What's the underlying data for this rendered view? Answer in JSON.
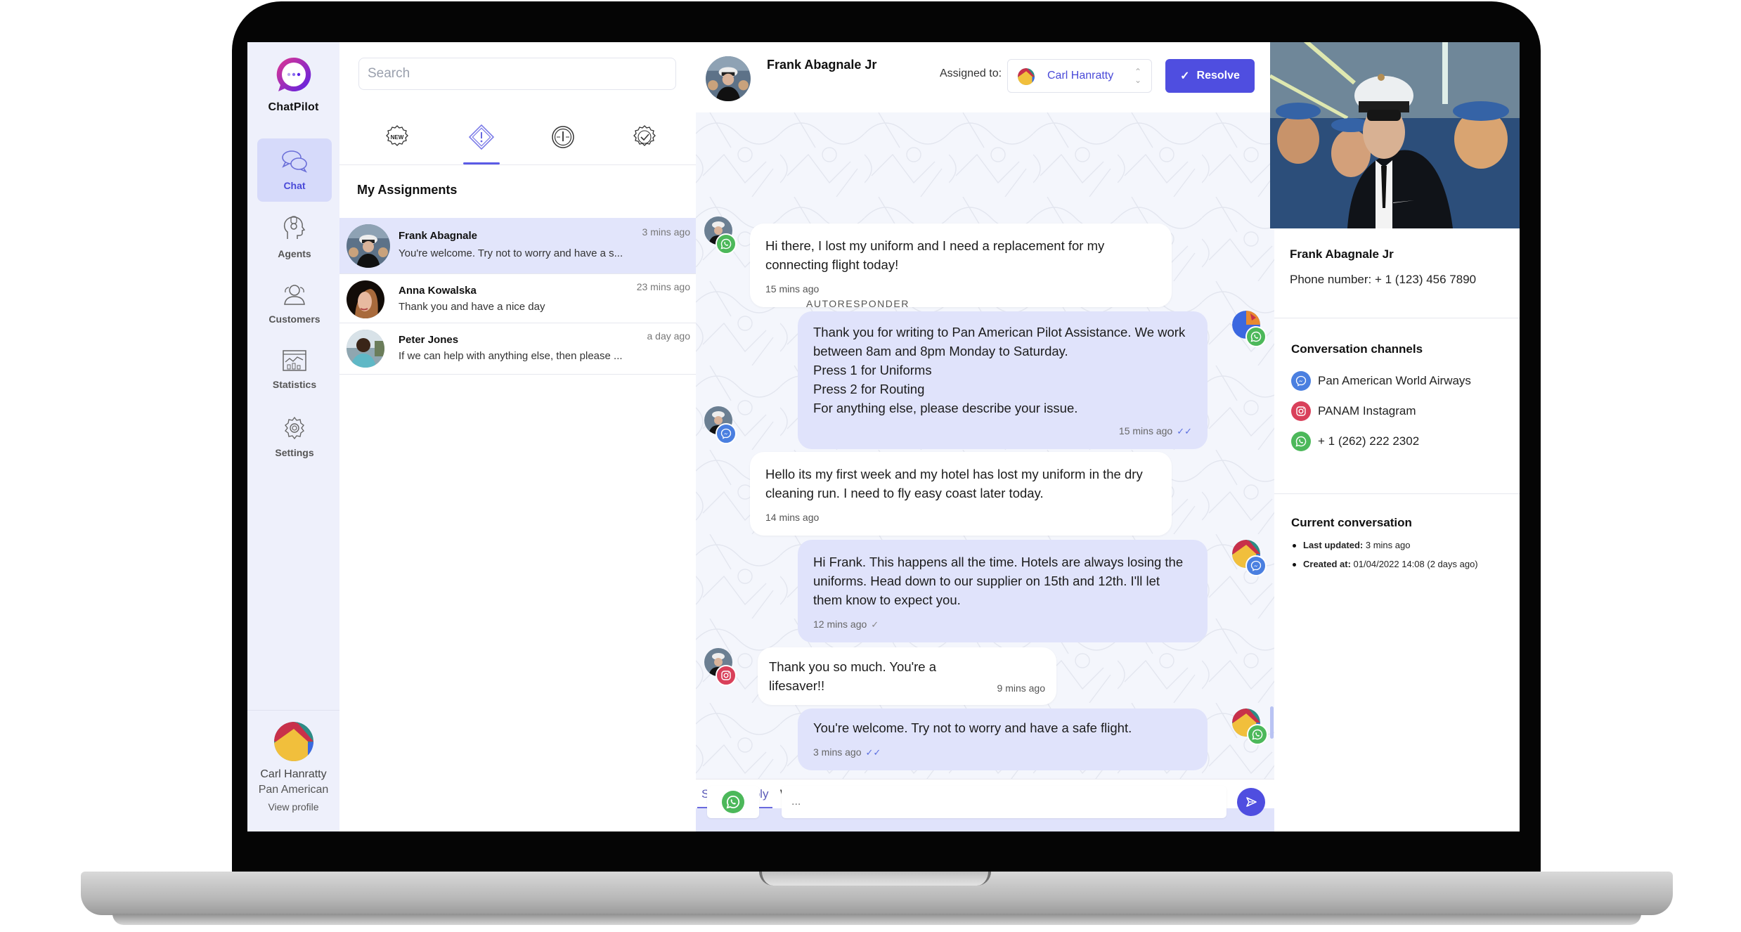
{
  "app": {
    "name": "ChatPilot",
    "brand_color": "#4f4ee0",
    "accent_light": "#e0e3fb"
  },
  "sidebar": {
    "items": [
      {
        "label": "Chat",
        "icon": "chat-bubbles-icon",
        "active": true
      },
      {
        "label": "Agents",
        "icon": "agent-headset-icon",
        "active": false
      },
      {
        "label": "Customers",
        "icon": "customers-icon",
        "active": false
      },
      {
        "label": "Statistics",
        "icon": "statistics-icon",
        "active": false
      },
      {
        "label": "Settings",
        "icon": "settings-gear-icon",
        "active": false
      }
    ],
    "profile": {
      "name": "Carl Hanratty",
      "organization": "Pan American",
      "link_label": "View profile"
    }
  },
  "conversation_list": {
    "search_placeholder": "Search",
    "filter_tabs": [
      {
        "icon": "new-badge-icon",
        "label": "NEW",
        "active": false
      },
      {
        "icon": "alert-diamond-icon",
        "active": true
      },
      {
        "icon": "clock-icon",
        "active": false
      },
      {
        "icon": "checkmark-badge-icon",
        "active": false
      }
    ],
    "section_title": "My Assignments",
    "items": [
      {
        "name": "Frank Abagnale",
        "preview": "You're welcome. Try not to worry and have a s...",
        "time": "3 mins ago",
        "active": true
      },
      {
        "name": "Anna Kowalska",
        "preview": "Thank you and have a nice day",
        "time": "23 mins ago",
        "active": false
      },
      {
        "name": "Peter Jones",
        "preview": "If we can help with anything else, then please ...",
        "time": "a day ago",
        "active": false
      }
    ]
  },
  "chat": {
    "contact_name": "Frank Abagnale Jr",
    "assigned_label": "Assigned to:",
    "assignee": "Carl Hanratty",
    "resolve_label": "Resolve",
    "messages": [
      {
        "direction": "in",
        "channel": "whatsapp",
        "text": "Hi there, I lost my uniform and I need a replacement for my connecting flight today!",
        "time": "15 mins ago"
      },
      {
        "direction": "out",
        "channel": "whatsapp",
        "label": "AUTORESPONDER",
        "lines": [
          "Thank you for writing to Pan American Pilot Assistance. We work between 8am and 8pm Monday to Saturday.",
          "Press 1 for Uniforms",
          "Press 2 for Routing",
          "For anything else, please describe your issue."
        ],
        "time": "15 mins ago",
        "status": "read"
      },
      {
        "direction": "in",
        "channel": "messenger",
        "text": "Hello its my first week and my hotel has lost my uniform in the dry cleaning run. I need to fly easy coast later today.",
        "time": "14 mins ago"
      },
      {
        "direction": "out",
        "channel": "messenger",
        "text": "Hi Frank. This happens all the time. Hotels are always losing the uniforms. Head down to our supplier on 15th and 12th. I'll let them know to expect you.",
        "time": "12 mins ago",
        "status": "sent"
      },
      {
        "direction": "in",
        "channel": "instagram",
        "text": "Thank you so much. You're a lifesaver!!",
        "time": "9 mins ago"
      },
      {
        "direction": "out",
        "channel": "whatsapp",
        "text": "You're welcome. Try not to worry and have a safe flight.",
        "time": "3 mins ago",
        "status": "read"
      }
    ],
    "reply_tabs": [
      {
        "label": "Send a reply",
        "active": true
      },
      {
        "label": "Write internal note",
        "active": false
      }
    ],
    "composer": {
      "placeholder": "...",
      "value": "",
      "channel": "whatsapp"
    }
  },
  "contact_panel": {
    "name": "Frank Abagnale Jr",
    "phone": "Phone number: + 1 (123) 456 7890",
    "channels_title": "Conversation channels",
    "channels": [
      {
        "type": "messenger",
        "label": "Pan American World Airways",
        "color": "#4a7fe0"
      },
      {
        "type": "instagram",
        "label": "PANAM Instagram",
        "color": "#d9405a"
      },
      {
        "type": "whatsapp",
        "label": "+ 1 (262) 222 2302",
        "color": "#4cb85a"
      }
    ],
    "current_title": "Current conversation",
    "meta": [
      {
        "label": "Last updated:",
        "value": "3 mins ago"
      },
      {
        "label": "Created at:",
        "value": "01/04/2022 14:08 (2 days ago)"
      }
    ]
  }
}
